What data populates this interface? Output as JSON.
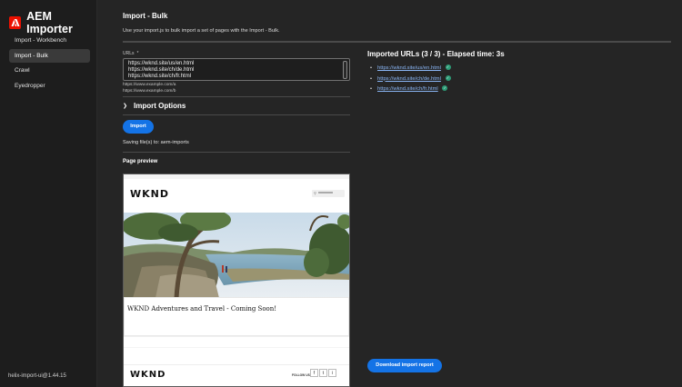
{
  "app": {
    "title": "AEM Importer",
    "version": "helix-import-ui@1.44.15"
  },
  "sidebar": {
    "items": [
      {
        "label": "Import - Workbench",
        "active": false
      },
      {
        "label": "Import - Bulk",
        "active": true
      },
      {
        "label": "Crawl",
        "active": false
      },
      {
        "label": "Eyedropper",
        "active": false
      }
    ]
  },
  "main": {
    "title": "Import - Bulk",
    "description": "Use your import.js to bulk import a set of pages with the Import - Bulk.",
    "urls_label": "URLs",
    "urls_required_marker": "*",
    "urls_lines": [
      "https://wknd.site/us/en.html",
      "https://wknd.site/ch/de.html",
      "https://wknd.site/ch/fr.html"
    ],
    "placeholder_lines": [
      "https://www.example.com/a",
      "https://www.example.com/b"
    ],
    "import_options_label": "Import Options",
    "import_button": "Import",
    "saving_text": "Saving file(s) to: aem-imports",
    "preview_title": "Page preview"
  },
  "preview_page": {
    "logo": "WKND",
    "heading": "WKND Adventures and Travel - Coming Soon!",
    "footer_logo": "WKND",
    "follow_label": "FOLLOW US",
    "social": [
      "f",
      "t",
      "i"
    ]
  },
  "results": {
    "title": "Imported URLs (3 / 3) - Elapsed time: 3s",
    "urls": [
      "https://wknd.site/us/en.html",
      "https://wknd.site/ch/de.html",
      "https://wknd.site/ch/fr.html"
    ],
    "status": "success",
    "download_button": "Download import report"
  },
  "colors": {
    "accent": "#1473e6",
    "brand": "#eb1000",
    "success": "#2d9d78",
    "link": "#8ab6f5"
  }
}
